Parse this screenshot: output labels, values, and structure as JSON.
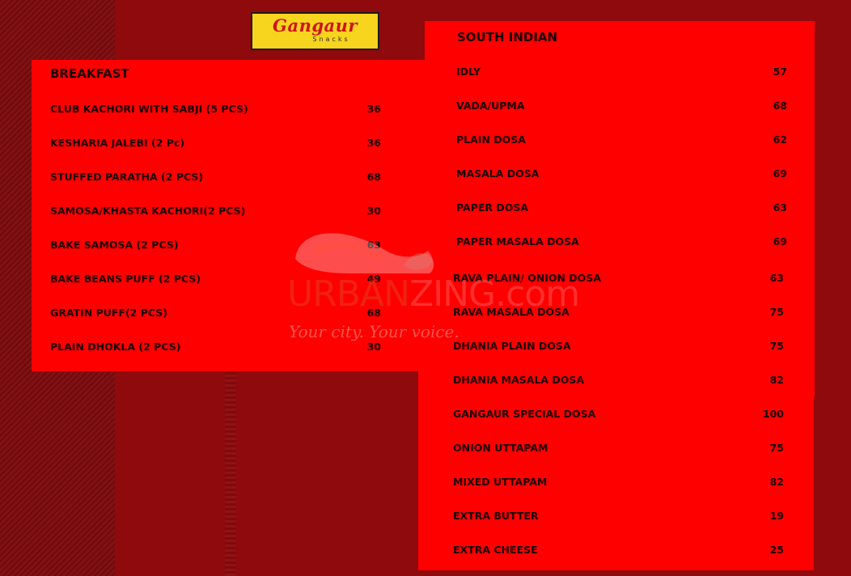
{
  "logo": {
    "brand": "Gangaur",
    "sub": "Snacks"
  },
  "watermark": {
    "text_a": "URBAN",
    "text_b": "ZING",
    "text_c": ".com",
    "tagline": "Your city. Your voice."
  },
  "breakfast": {
    "title": "BREAKFAST",
    "items": [
      {
        "name": "CLUB KACHORI WITH SABJI (5 PCS)",
        "price": "36"
      },
      {
        "name": "KESHARIA JALEBI (2 Pc)",
        "price": "36"
      },
      {
        "name": "STUFFED PARATHA (2 PCS)",
        "price": "68"
      },
      {
        "name": "SAMOSA/KHASTA KACHORI(2 PCS)",
        "price": "30"
      },
      {
        "name": "BAKE SAMOSA (2 PCS)",
        "price": "63"
      },
      {
        "name": "BAKE BEANS PUFF (2 PCS)",
        "price": "49"
      },
      {
        "name": "GRATIN PUFF(2 PCS)",
        "price": "68"
      },
      {
        "name": "PLAIN DHOKLA (2 PCS)",
        "price": "30"
      }
    ]
  },
  "south_indian": {
    "title": "SOUTH INDIAN",
    "items": [
      {
        "name": "IDLY",
        "price": "57"
      },
      {
        "name": "VADA/UPMA",
        "price": "68"
      },
      {
        "name": "PLAIN DOSA",
        "price": "62"
      },
      {
        "name": "MASALA DOSA",
        "price": "69"
      },
      {
        "name": "PAPER DOSA",
        "price": "63"
      },
      {
        "name": "PAPER MASALA DOSA",
        "price": "69"
      },
      {
        "name": "RAVA PLAIN/ ONION DOSA",
        "price": "63"
      },
      {
        "name": "RAVA MASALA DOSA",
        "price": "75"
      },
      {
        "name": "DHANIA PLAIN DOSA",
        "price": "75"
      },
      {
        "name": "DHANIA MASALA DOSA",
        "price": "82"
      },
      {
        "name": "GANGAUR SPECIAL DOSA",
        "price": "100"
      },
      {
        "name": "ONION UTTAPAM",
        "price": "75"
      },
      {
        "name": "MIXED UTTAPAM",
        "price": "82"
      },
      {
        "name": "EXTRA BUTTER",
        "price": "19"
      },
      {
        "name": "EXTRA CHEESE",
        "price": "25"
      }
    ]
  }
}
